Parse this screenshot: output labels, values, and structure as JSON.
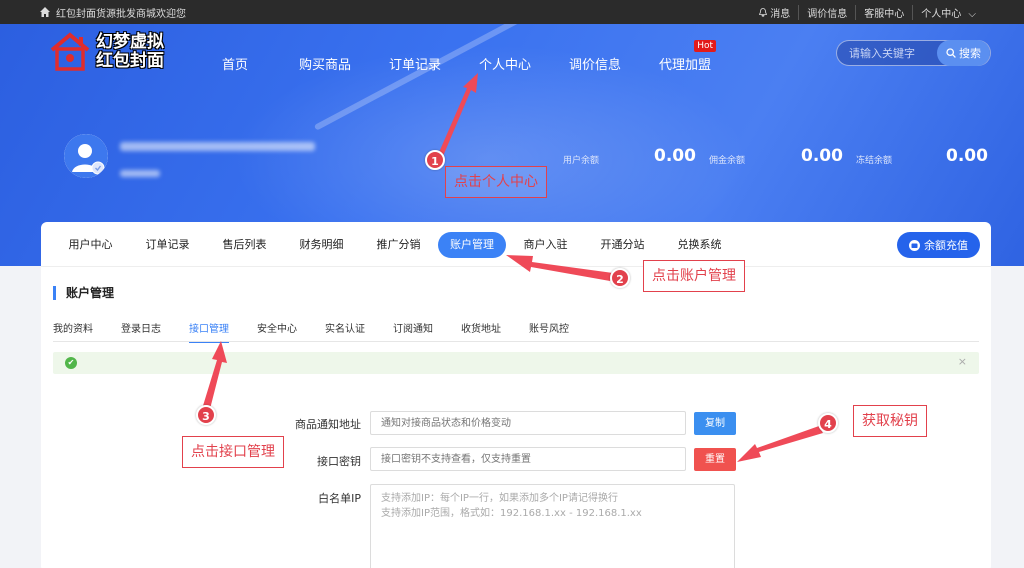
{
  "topbar": {
    "welcome": "红包封面货源批发商城欢迎您",
    "links": [
      "消息",
      "调价信息",
      "客服中心",
      "个人中心"
    ]
  },
  "logo": {
    "line1": "幻梦虚拟",
    "line2": "红包封面"
  },
  "nav": {
    "items": [
      "首页",
      "购买商品",
      "订单记录",
      "个人中心",
      "调价信息",
      "代理加盟"
    ],
    "hot_badge": "Hot"
  },
  "search": {
    "placeholder": "请输入关键字",
    "button": "搜索"
  },
  "balances": [
    {
      "label": "用户余额",
      "value": "0.00"
    },
    {
      "label": "佣金余额",
      "value": "0.00"
    },
    {
      "label": "冻结余额",
      "value": "0.00"
    }
  ],
  "tabs": {
    "items": [
      "用户中心",
      "订单记录",
      "售后列表",
      "财务明细",
      "推广分销",
      "账户管理",
      "商户入驻",
      "开通分站",
      "兑换系统"
    ],
    "recharge": "余额充值"
  },
  "section_title": "账户管理",
  "subtabs": [
    "我的资料",
    "登录日志",
    "接口管理",
    "安全中心",
    "实名认证",
    "订阅通知",
    "收货地址",
    "账号风控"
  ],
  "alert": {
    "close": "×"
  },
  "form": {
    "notify_label": "商品通知地址",
    "notify_placeholder": "通知对接商品状态和价格变动",
    "copy_button": "复制",
    "key_label": "接口密钥",
    "key_placeholder": "接口密钥不支持查看，仅支持重置",
    "reset_button": "重置",
    "whitelist_label": "白名单IP",
    "whitelist_hint1": "支持添加IP：每个IP一行，如果添加多个IP请记得换行",
    "whitelist_hint2": "支持添加IP范围，格式如：192.168.1.xx - 192.168.1.xx"
  },
  "annotations": [
    {
      "num": "1",
      "text": "点击个人中心"
    },
    {
      "num": "2",
      "text": "点击账户管理"
    },
    {
      "num": "3",
      "text": "点击接口管理"
    },
    {
      "num": "4",
      "text": "获取秘钥"
    }
  ],
  "colors": {
    "primary": "#3b82f6",
    "danger": "#f0524f",
    "annotation": "#e2414c",
    "topbar": "#2b2b2b"
  }
}
